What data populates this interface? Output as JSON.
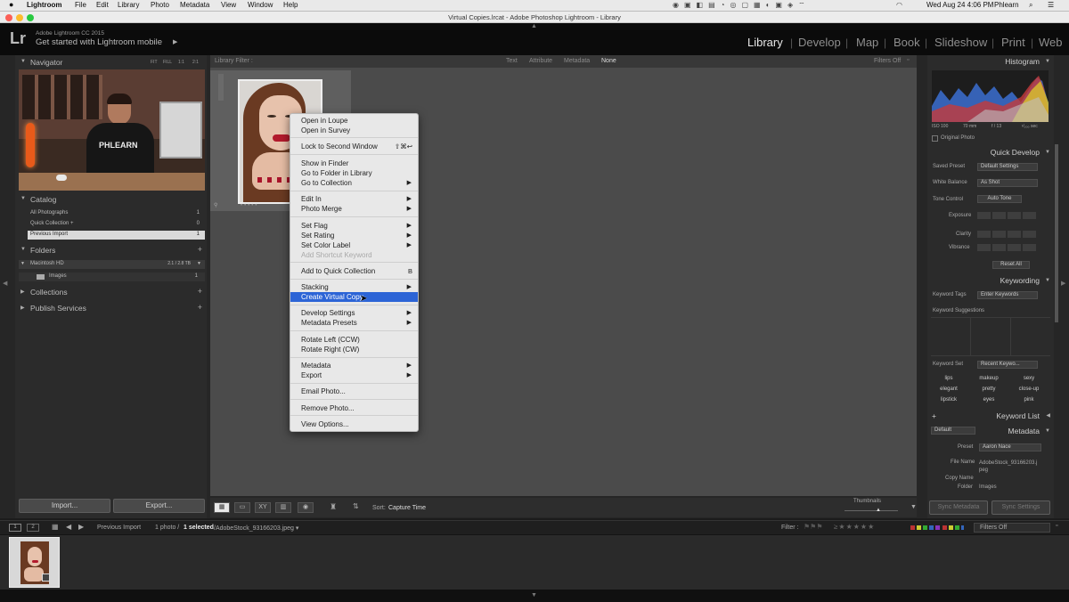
{
  "macos_menubar": {
    "app": "Lightroom",
    "menus": [
      "File",
      "Edit",
      "Library",
      "Photo",
      "Metadata",
      "View",
      "Window",
      "Help"
    ],
    "clock": "Wed Aug 24  4:06 PM",
    "user": "Phlearn"
  },
  "window": {
    "title": "Virtual Copies.lrcat - Adobe Photoshop Lightroom - Library"
  },
  "identity_plate": {
    "logo": "Lr",
    "product": "Adobe Lightroom CC 2015",
    "tagline": "Get started with Lightroom mobile",
    "modules": [
      "Library",
      "Develop",
      "Map",
      "Book",
      "Slideshow",
      "Print",
      "Web"
    ],
    "active_module": "Library"
  },
  "navigator": {
    "title": "Navigator",
    "zoom_options": [
      "FIT",
      "FILL",
      "1:1",
      "2:1"
    ],
    "shirt_text": "PHLEARN"
  },
  "catalog": {
    "title": "Catalog",
    "items": [
      {
        "label": "All Photographs",
        "count": "1"
      },
      {
        "label": "Quick Collection  +",
        "count": "0"
      },
      {
        "label": "Previous Import",
        "count": "1"
      }
    ]
  },
  "folders": {
    "title": "Folders",
    "volume": {
      "label": "Macintosh HD",
      "size": "2.1 / 2.8 TB"
    },
    "items": [
      {
        "label": "Images",
        "count": "1"
      }
    ]
  },
  "collections": {
    "title": "Collections"
  },
  "publish_services": {
    "title": "Publish Services"
  },
  "buttons": {
    "import": "Import...",
    "export": "Export..."
  },
  "library_filter": {
    "label": "Library Filter :",
    "options": [
      "Text",
      "Attribute",
      "Metadata",
      "None"
    ],
    "active": "None",
    "filters_off": "Filters Off"
  },
  "context_menu": {
    "items": [
      {
        "label": "Open in Loupe"
      },
      {
        "label": "Open in Survey"
      },
      {
        "sep": true
      },
      {
        "label": "Lock to Second Window",
        "shortcut": "⇧⌘↩"
      },
      {
        "sep": true
      },
      {
        "label": "Show in Finder"
      },
      {
        "label": "Go to Folder in Library"
      },
      {
        "label": "Go to Collection",
        "submenu": true
      },
      {
        "sep": true
      },
      {
        "label": "Edit In",
        "submenu": true
      },
      {
        "label": "Photo Merge",
        "submenu": true
      },
      {
        "sep": true
      },
      {
        "label": "Set Flag",
        "submenu": true
      },
      {
        "label": "Set Rating",
        "submenu": true
      },
      {
        "label": "Set Color Label",
        "submenu": true
      },
      {
        "label": "Add Shortcut Keyword",
        "disabled": true
      },
      {
        "sep": true
      },
      {
        "label": "Add to Quick Collection",
        "shortcut": "B"
      },
      {
        "sep": true
      },
      {
        "label": "Stacking",
        "submenu": true
      },
      {
        "label": "Create Virtual Copy",
        "highlighted": true
      },
      {
        "sep": true
      },
      {
        "label": "Develop Settings",
        "submenu": true
      },
      {
        "label": "Metadata Presets",
        "submenu": true
      },
      {
        "sep": true
      },
      {
        "label": "Rotate Left (CCW)"
      },
      {
        "label": "Rotate Right (CW)"
      },
      {
        "sep": true
      },
      {
        "label": "Metadata",
        "submenu": true
      },
      {
        "label": "Export",
        "submenu": true
      },
      {
        "sep": true
      },
      {
        "label": "Email Photo..."
      },
      {
        "sep": true
      },
      {
        "label": "Remove Photo..."
      },
      {
        "sep": true
      },
      {
        "label": "View Options..."
      }
    ]
  },
  "toolbar": {
    "sort_label": "Sort:",
    "sort_value": "Capture Time",
    "thumbnails_label": "Thumbnails"
  },
  "histogram": {
    "title": "Histogram",
    "iso": "ISO 100",
    "focal": "70 mm",
    "aperture": "f / 13",
    "shutter": "¹⁄₂₀₀ sec",
    "original_photo": "Original Photo"
  },
  "quick_develop": {
    "title": "Quick Develop",
    "saved_preset": {
      "label": "Saved Preset",
      "value": "Default Settings"
    },
    "white_balance": {
      "label": "White Balance",
      "value": "As Shot"
    },
    "tone_control": {
      "label": "Tone Control",
      "value": "Auto Tone"
    },
    "sliders": [
      "Exposure",
      "Clarity",
      "Vibrance"
    ],
    "reset": "Reset All"
  },
  "keywording": {
    "title": "Keywording",
    "keyword_tags": {
      "label": "Keyword Tags",
      "value": "Enter Keywords"
    },
    "suggestions_label": "Keyword Suggestions",
    "keyword_set": {
      "label": "Keyword Set",
      "value": "Recent Keywo..."
    },
    "keywords": [
      "lips",
      "makeup",
      "sexy",
      "elegant",
      "pretty",
      "close-up",
      "lipstick",
      "eyes",
      "pink"
    ]
  },
  "keyword_list": {
    "title": "Keyword List"
  },
  "metadata": {
    "title": "Metadata",
    "preset_dropdown": "Default",
    "preset": {
      "label": "Preset",
      "value": "Aaron Nace"
    },
    "file_name": {
      "label": "File Name",
      "value": "AdobeStock_93166203.jpeg"
    },
    "copy_name": {
      "label": "Copy Name",
      "value": ""
    },
    "folder": {
      "label": "Folder",
      "value": "Images"
    }
  },
  "sync": {
    "metadata": "Sync Metadata",
    "settings": "Sync Settings"
  },
  "filmstrip_bar": {
    "source": "Previous Import",
    "count": "1 photo /",
    "selected": "1 selected",
    "filename": "/AdobeStock_93166203.jpeg ▾",
    "filter_label": "Filter :",
    "filters_off": "Filters Off"
  },
  "colors": {
    "menu_highlight": "#2c64d6",
    "panel": "#2b2b2b",
    "grid": "#4b4b4b",
    "lips": "#b21a2c"
  }
}
